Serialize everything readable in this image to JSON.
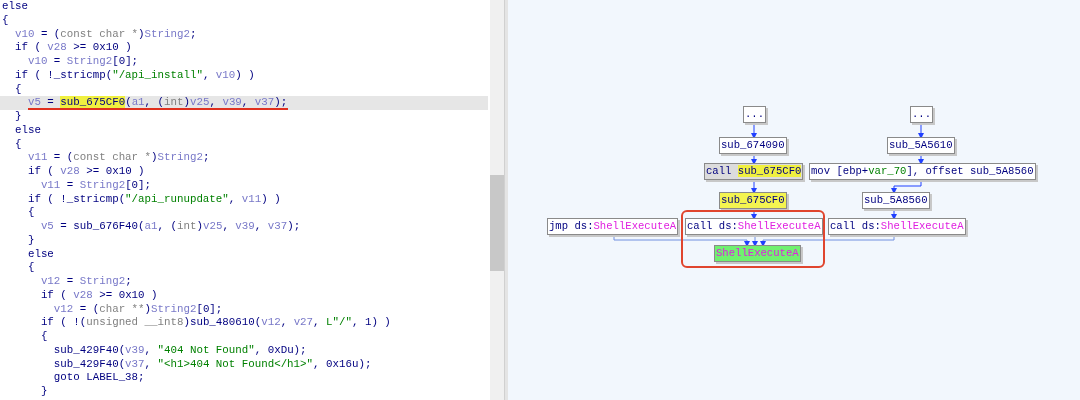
{
  "code_lines": [
    {
      "selected": false,
      "underlined": false,
      "tokens": [
        {
          "kind": "kw",
          "text": "else"
        }
      ]
    },
    {
      "selected": false,
      "underlined": false,
      "tokens": [
        {
          "kind": "kw",
          "text": "{"
        }
      ]
    },
    {
      "selected": false,
      "underlined": false,
      "tokens": [
        {
          "kind": "var",
          "text": "  v10"
        },
        {
          "kind": "kw",
          "text": " = ("
        },
        {
          "kind": "cast",
          "text": "const char *"
        },
        {
          "kind": "kw",
          "text": ")"
        },
        {
          "kind": "var",
          "text": "String2"
        },
        {
          "kind": "kw",
          "text": ";"
        }
      ]
    },
    {
      "selected": false,
      "underlined": false,
      "tokens": [
        {
          "kind": "kw",
          "text": "  if ( "
        },
        {
          "kind": "var",
          "text": "v28"
        },
        {
          "kind": "kw",
          "text": " >= 0x10 )"
        }
      ]
    },
    {
      "selected": false,
      "underlined": false,
      "tokens": [
        {
          "kind": "var",
          "text": "    v10"
        },
        {
          "kind": "kw",
          "text": " = "
        },
        {
          "kind": "var",
          "text": "String2"
        },
        {
          "kind": "kw",
          "text": "[0];"
        }
      ]
    },
    {
      "selected": false,
      "underlined": false,
      "tokens": [
        {
          "kind": "kw",
          "text": "  if ( !_stricmp("
        },
        {
          "kind": "str",
          "text": "\"/api_install\""
        },
        {
          "kind": "kw",
          "text": ", "
        },
        {
          "kind": "var",
          "text": "v10"
        },
        {
          "kind": "kw",
          "text": ") )"
        }
      ]
    },
    {
      "selected": false,
      "underlined": false,
      "tokens": [
        {
          "kind": "kw",
          "text": "  {"
        }
      ]
    },
    {
      "selected": true,
      "underlined": true,
      "tokens": [
        {
          "kind": "var",
          "text": "    v5"
        },
        {
          "kind": "kw",
          "text": " = "
        },
        {
          "kind": "func_hl",
          "text": "sub_675CF0"
        },
        {
          "kind": "kw",
          "text": "("
        },
        {
          "kind": "var",
          "text": "a1"
        },
        {
          "kind": "kw",
          "text": ", ("
        },
        {
          "kind": "cast",
          "text": "int"
        },
        {
          "kind": "kw",
          "text": ")"
        },
        {
          "kind": "var",
          "text": "v25"
        },
        {
          "kind": "kw",
          "text": ", "
        },
        {
          "kind": "var",
          "text": "v39"
        },
        {
          "kind": "kw",
          "text": ", "
        },
        {
          "kind": "var",
          "text": "v37"
        },
        {
          "kind": "kw",
          "text": ");"
        }
      ]
    },
    {
      "selected": false,
      "underlined": false,
      "tokens": [
        {
          "kind": "kw",
          "text": "  }"
        }
      ]
    },
    {
      "selected": false,
      "underlined": false,
      "tokens": [
        {
          "kind": "kw",
          "text": "  else"
        }
      ]
    },
    {
      "selected": false,
      "underlined": false,
      "tokens": [
        {
          "kind": "kw",
          "text": "  {"
        }
      ]
    },
    {
      "selected": false,
      "underlined": false,
      "tokens": [
        {
          "kind": "var",
          "text": "    v11"
        },
        {
          "kind": "kw",
          "text": " = ("
        },
        {
          "kind": "cast",
          "text": "const char *"
        },
        {
          "kind": "kw",
          "text": ")"
        },
        {
          "kind": "var",
          "text": "String2"
        },
        {
          "kind": "kw",
          "text": ";"
        }
      ]
    },
    {
      "selected": false,
      "underlined": false,
      "tokens": [
        {
          "kind": "kw",
          "text": "    if ( "
        },
        {
          "kind": "var",
          "text": "v28"
        },
        {
          "kind": "kw",
          "text": " >= 0x10 )"
        }
      ]
    },
    {
      "selected": false,
      "underlined": false,
      "tokens": [
        {
          "kind": "var",
          "text": "      v11"
        },
        {
          "kind": "kw",
          "text": " = "
        },
        {
          "kind": "var",
          "text": "String2"
        },
        {
          "kind": "kw",
          "text": "[0];"
        }
      ]
    },
    {
      "selected": false,
      "underlined": false,
      "tokens": [
        {
          "kind": "kw",
          "text": "    if ( !_stricmp("
        },
        {
          "kind": "str",
          "text": "\"/api_runupdate\""
        },
        {
          "kind": "kw",
          "text": ", "
        },
        {
          "kind": "var",
          "text": "v11"
        },
        {
          "kind": "kw",
          "text": ") )"
        }
      ]
    },
    {
      "selected": false,
      "underlined": false,
      "tokens": [
        {
          "kind": "kw",
          "text": "    {"
        }
      ]
    },
    {
      "selected": false,
      "underlined": false,
      "tokens": [
        {
          "kind": "var",
          "text": "      v5"
        },
        {
          "kind": "kw",
          "text": " = sub_676F40("
        },
        {
          "kind": "var",
          "text": "a1"
        },
        {
          "kind": "kw",
          "text": ", ("
        },
        {
          "kind": "cast",
          "text": "int"
        },
        {
          "kind": "kw",
          "text": ")"
        },
        {
          "kind": "var",
          "text": "v25"
        },
        {
          "kind": "kw",
          "text": ", "
        },
        {
          "kind": "var",
          "text": "v39"
        },
        {
          "kind": "kw",
          "text": ", "
        },
        {
          "kind": "var",
          "text": "v37"
        },
        {
          "kind": "kw",
          "text": ");"
        }
      ]
    },
    {
      "selected": false,
      "underlined": false,
      "tokens": [
        {
          "kind": "kw",
          "text": "    }"
        }
      ]
    },
    {
      "selected": false,
      "underlined": false,
      "tokens": [
        {
          "kind": "kw",
          "text": "    else"
        }
      ]
    },
    {
      "selected": false,
      "underlined": false,
      "tokens": [
        {
          "kind": "kw",
          "text": "    {"
        }
      ]
    },
    {
      "selected": false,
      "underlined": false,
      "tokens": [
        {
          "kind": "var",
          "text": "      v12"
        },
        {
          "kind": "kw",
          "text": " = "
        },
        {
          "kind": "var",
          "text": "String2"
        },
        {
          "kind": "kw",
          "text": ";"
        }
      ]
    },
    {
      "selected": false,
      "underlined": false,
      "tokens": [
        {
          "kind": "kw",
          "text": "      if ( "
        },
        {
          "kind": "var",
          "text": "v28"
        },
        {
          "kind": "kw",
          "text": " >= 0x10 )"
        }
      ]
    },
    {
      "selected": false,
      "underlined": false,
      "tokens": [
        {
          "kind": "var",
          "text": "        v12"
        },
        {
          "kind": "kw",
          "text": " = ("
        },
        {
          "kind": "cast",
          "text": "char **"
        },
        {
          "kind": "kw",
          "text": ")"
        },
        {
          "kind": "var",
          "text": "String2"
        },
        {
          "kind": "kw",
          "text": "[0];"
        }
      ]
    },
    {
      "selected": false,
      "underlined": false,
      "tokens": [
        {
          "kind": "kw",
          "text": "      if ( !("
        },
        {
          "kind": "cast",
          "text": "unsigned __int8"
        },
        {
          "kind": "kw",
          "text": ")sub_480610("
        },
        {
          "kind": "var",
          "text": "v12"
        },
        {
          "kind": "kw",
          "text": ", "
        },
        {
          "kind": "var",
          "text": "v27"
        },
        {
          "kind": "kw",
          "text": ", "
        },
        {
          "kind": "str",
          "text": "L\"/\""
        },
        {
          "kind": "kw",
          "text": ", 1) )"
        }
      ]
    },
    {
      "selected": false,
      "underlined": false,
      "tokens": [
        {
          "kind": "kw",
          "text": "      {"
        }
      ]
    },
    {
      "selected": false,
      "underlined": false,
      "tokens": [
        {
          "kind": "kw",
          "text": "        sub_429F40("
        },
        {
          "kind": "var",
          "text": "v39"
        },
        {
          "kind": "kw",
          "text": ", "
        },
        {
          "kind": "str",
          "text": "\"404 Not Found\""
        },
        {
          "kind": "kw",
          "text": ", 0xDu);"
        }
      ]
    },
    {
      "selected": false,
      "underlined": false,
      "tokens": [
        {
          "kind": "kw",
          "text": "        sub_429F40("
        },
        {
          "kind": "var",
          "text": "v37"
        },
        {
          "kind": "kw",
          "text": ", "
        },
        {
          "kind": "str",
          "text": "\"<h1>404 Not Found</h1>\""
        },
        {
          "kind": "kw",
          "text": ", 0x16u);"
        }
      ]
    },
    {
      "selected": false,
      "underlined": false,
      "tokens": [
        {
          "kind": "kw",
          "text": "        goto LABEL_38;"
        }
      ]
    },
    {
      "selected": false,
      "underlined": false,
      "tokens": [
        {
          "kind": "kw",
          "text": "      }"
        }
      ]
    }
  ],
  "graph_nodes": [
    {
      "kind": "plain",
      "tokens": [
        {
          "kind": "kw",
          "text": "..."
        }
      ]
    },
    {
      "kind": "plain",
      "tokens": [
        {
          "kind": "kw",
          "text": "sub_674090"
        }
      ]
    },
    {
      "kind": "call",
      "tokens": [
        {
          "kind": "kw",
          "text": "call "
        },
        {
          "kind": "func_hl",
          "text": "sub_675CF0"
        }
      ]
    },
    {
      "kind": "highlight",
      "tokens": [
        {
          "kind": "kw",
          "text": "sub_675CF0"
        }
      ]
    },
    {
      "kind": "plain",
      "tokens": [
        {
          "kind": "kw",
          "text": "jmp ds:"
        },
        {
          "kind": "import",
          "text": "ShellExecuteA"
        }
      ]
    },
    {
      "kind": "plain",
      "tokens": [
        {
          "kind": "kw",
          "text": "call ds:"
        },
        {
          "kind": "import",
          "text": "ShellExecuteA"
        }
      ]
    },
    {
      "kind": "plain",
      "tokens": [
        {
          "kind": "kw",
          "text": "call ds:"
        },
        {
          "kind": "import",
          "text": "ShellExecuteA"
        }
      ]
    },
    {
      "kind": "target",
      "tokens": [
        {
          "kind": "import",
          "text": "ShellExecuteA"
        }
      ]
    },
    {
      "kind": "plain",
      "tokens": [
        {
          "kind": "kw",
          "text": "..."
        }
      ]
    },
    {
      "kind": "plain",
      "tokens": [
        {
          "kind": "kw",
          "text": "sub_5A5610"
        }
      ]
    },
    {
      "kind": "plain",
      "tokens": [
        {
          "kind": "kw",
          "text": "mov [ebp+"
        },
        {
          "kind": "local",
          "text": "var_70"
        },
        {
          "kind": "kw",
          "text": "], offset sub_5A8560"
        }
      ]
    },
    {
      "kind": "plain",
      "tokens": [
        {
          "kind": "kw",
          "text": "sub_5A8560"
        }
      ]
    }
  ]
}
